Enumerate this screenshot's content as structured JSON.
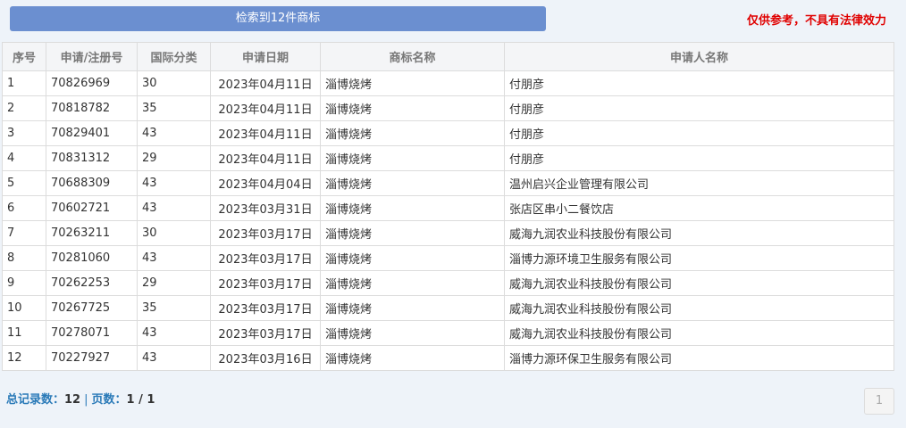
{
  "header": {
    "search_button": "检索到12件商标",
    "disclaimer": "仅供参考，不具有法律效力"
  },
  "table": {
    "headers": [
      "序号",
      "申请/注册号",
      "国际分类",
      "申请日期",
      "商标名称",
      "申请人名称"
    ],
    "rows": [
      {
        "idx": "1",
        "reg": "70826969",
        "cls": "30",
        "date": "2023年04月11日",
        "mark": "淄博烧烤",
        "applicant": "付朋彦"
      },
      {
        "idx": "2",
        "reg": "70818782",
        "cls": "35",
        "date": "2023年04月11日",
        "mark": "淄博烧烤",
        "applicant": "付朋彦"
      },
      {
        "idx": "3",
        "reg": "70829401",
        "cls": "43",
        "date": "2023年04月11日",
        "mark": "淄博烧烤",
        "applicant": "付朋彦"
      },
      {
        "idx": "4",
        "reg": "70831312",
        "cls": "29",
        "date": "2023年04月11日",
        "mark": "淄博烧烤",
        "applicant": "付朋彦"
      },
      {
        "idx": "5",
        "reg": "70688309",
        "cls": "43",
        "date": "2023年04月04日",
        "mark": "淄博烧烤",
        "applicant": "温州启兴企业管理有限公司"
      },
      {
        "idx": "6",
        "reg": "70602721",
        "cls": "43",
        "date": "2023年03月31日",
        "mark": "淄博烧烤",
        "applicant": "张店区串小二餐饮店"
      },
      {
        "idx": "7",
        "reg": "70263211",
        "cls": "30",
        "date": "2023年03月17日",
        "mark": "淄博烧烤",
        "applicant": "威海九润农业科技股份有限公司"
      },
      {
        "idx": "8",
        "reg": "70281060",
        "cls": "43",
        "date": "2023年03月17日",
        "mark": "淄博烧烤",
        "applicant": "淄博力源环境卫生服务有限公司"
      },
      {
        "idx": "9",
        "reg": "70262253",
        "cls": "29",
        "date": "2023年03月17日",
        "mark": "淄博烧烤",
        "applicant": "威海九润农业科技股份有限公司"
      },
      {
        "idx": "10",
        "reg": "70267725",
        "cls": "35",
        "date": "2023年03月17日",
        "mark": "淄博烧烤",
        "applicant": "威海九润农业科技股份有限公司"
      },
      {
        "idx": "11",
        "reg": "70278071",
        "cls": "43",
        "date": "2023年03月17日",
        "mark": "淄博烧烤",
        "applicant": "威海九润农业科技股份有限公司"
      },
      {
        "idx": "12",
        "reg": "70227927",
        "cls": "43",
        "date": "2023年03月16日",
        "mark": "淄博烧烤",
        "applicant": "淄博力源环保卫生服务有限公司"
      }
    ]
  },
  "footer": {
    "total_label": "总记录数：",
    "total_value": "12",
    "separator": "|",
    "pages_label": "页数：",
    "pages_value": "1 / 1",
    "page_button": "1"
  },
  "colors": {
    "button_bg": "#6b8fd0",
    "link": "#2a7ab8",
    "disclaimer": "#e00000"
  }
}
